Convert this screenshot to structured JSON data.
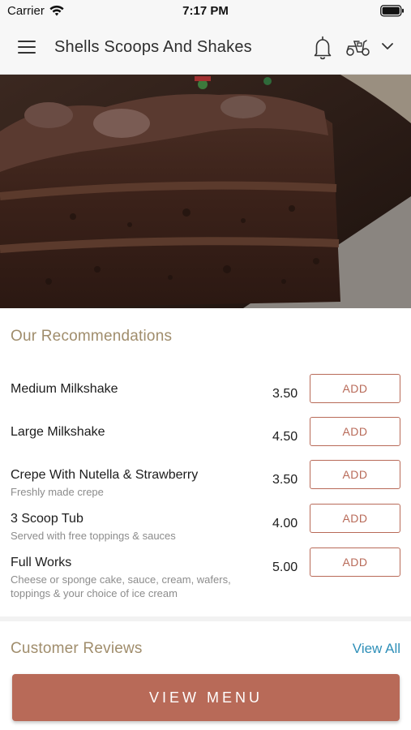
{
  "status_bar": {
    "carrier": "Carrier",
    "time": "7:17 PM"
  },
  "header": {
    "title": "Shells Scoops And Shakes",
    "icons": [
      "menu-icon",
      "bell-icon",
      "scooter-icon",
      "chevron-down-icon"
    ]
  },
  "hero": {
    "image": "chocolate-cake-slice"
  },
  "recommendations": {
    "title": "Our Recommendations",
    "items": [
      {
        "name": "Medium Milkshake",
        "description": "",
        "price": "3.50",
        "button": "ADD"
      },
      {
        "name": "Large Milkshake",
        "description": "",
        "price": "4.50",
        "button": "ADD"
      },
      {
        "name": "Crepe With Nutella & Strawberry",
        "description": "Freshly made crepe",
        "price": "3.50",
        "button": "ADD"
      },
      {
        "name": "3 Scoop Tub",
        "description": "Served with free toppings & sauces",
        "price": "4.00",
        "button": "ADD"
      },
      {
        "name": "Full Works",
        "description": "Cheese or sponge cake, sauce, cream, wafers, toppings & your choice of ice cream",
        "price": "5.00",
        "button": "ADD"
      }
    ]
  },
  "reviews": {
    "title": "Customer Reviews",
    "view_all": "View All"
  },
  "footer": {
    "view_menu": "VIEW MENU"
  },
  "colors": {
    "accent": "#b86a58",
    "section_title": "#a08d6c",
    "link": "#2e8fb8"
  }
}
